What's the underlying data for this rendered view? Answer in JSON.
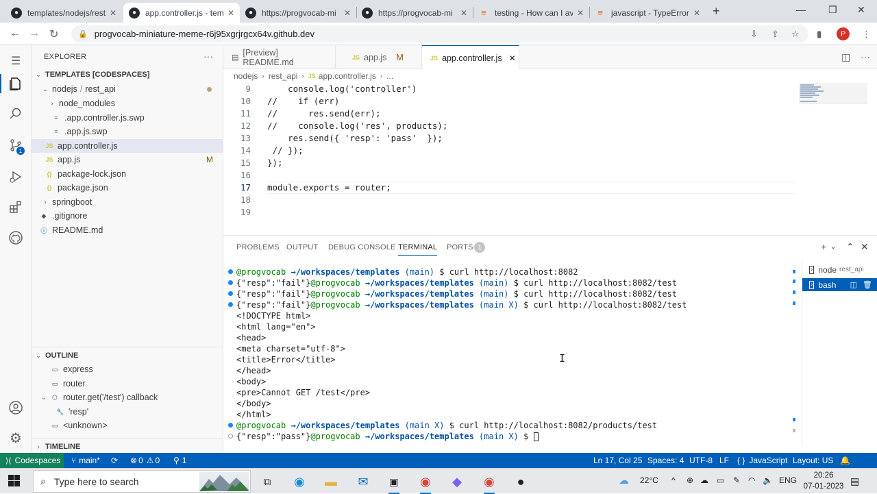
{
  "browser": {
    "tabs": [
      {
        "title": "templates/nodejs/rest"
      },
      {
        "title": "app.controller.js - tem"
      },
      {
        "title": "https://progvocab-mi"
      },
      {
        "title": "https://progvocab-mi"
      },
      {
        "title": "testing - How can I av"
      },
      {
        "title": "javascript - TypeError"
      }
    ],
    "url": "progvocab-miniature-meme-r6j95xgrjrgcx64v.github.dev",
    "profile_initial": "P"
  },
  "sidebar": {
    "title": "EXPLORER",
    "workspace": "TEMPLATES [CODESPACES]",
    "breadcrumb_folder": "nodejs",
    "breadcrumb_sub": "rest_api",
    "files": [
      {
        "label": "node_modules",
        "type": "folder"
      },
      {
        "label": ".app.controller.js.swp",
        "type": "swp"
      },
      {
        "label": ".app.js.swp",
        "type": "swp"
      },
      {
        "label": "app.controller.js",
        "type": "js",
        "selected": true
      },
      {
        "label": "app.js",
        "type": "js",
        "modified": "M"
      },
      {
        "label": "package-lock.json",
        "type": "json"
      },
      {
        "label": "package.json",
        "type": "json"
      },
      {
        "label": "springboot",
        "type": "folder"
      },
      {
        "label": ".gitignore",
        "type": "git"
      },
      {
        "label": "README.md",
        "type": "md"
      }
    ],
    "outline_title": "OUTLINE",
    "outline": [
      {
        "label": "express"
      },
      {
        "label": "router"
      },
      {
        "label": "router.get('/test') callback"
      },
      {
        "label": "'resp'"
      },
      {
        "label": "<unknown>"
      }
    ],
    "timeline_title": "TIMELINE"
  },
  "editor": {
    "tabs": [
      {
        "label": "[Preview] README.md"
      },
      {
        "label": "app.js",
        "mark": "M"
      },
      {
        "label": "app.controller.js"
      }
    ],
    "breadcrumb": [
      "nodejs",
      "rest_api",
      "app.controller.js",
      "..."
    ],
    "lines": [
      {
        "n": "9",
        "text": "    console.log('controller')"
      },
      {
        "n": "10",
        "text": "//    if (err)"
      },
      {
        "n": "11",
        "text": "//      res.send(err);"
      },
      {
        "n": "12",
        "text": "//    console.log('res', products);"
      },
      {
        "n": "13",
        "text": "    res.send({ 'resp': 'pass'  });"
      },
      {
        "n": "14",
        "text": " // });"
      },
      {
        "n": "15",
        "text": "});"
      },
      {
        "n": "16",
        "text": ""
      },
      {
        "n": "17",
        "text": "module.exports = router;"
      },
      {
        "n": "18",
        "text": ""
      },
      {
        "n": "19",
        "text": ""
      }
    ]
  },
  "panel": {
    "tabs": [
      "PROBLEMS",
      "OUTPUT",
      "DEBUG CONSOLE",
      "TERMINAL",
      "PORTS"
    ],
    "ports_count": "1",
    "terminals": [
      {
        "name": "node",
        "sub": "rest_api"
      },
      {
        "name": "bash"
      }
    ],
    "prompt_user": "@progvocab",
    "prompt_path": "/workspaces/templates",
    "prompt_branch": "(main)",
    "prompt_branch_x": "(main X)",
    "lines": [
      {
        "pre": "",
        "branch": "(main)",
        "cmd": " $ curl http://localhost:8082"
      },
      {
        "pre": "{\"resp\":\"fail\"}",
        "branch": "(main)",
        "cmd": " $ curl http://localhost:8082/test"
      },
      {
        "pre": "{\"resp\":\"fail\"}",
        "branch": "(main)",
        "cmd": " $ curl http://localhost:8082/test"
      },
      {
        "pre": "{\"resp\":\"fail\"}",
        "branch": "(main X)",
        "cmd": " $ curl http://localhost:8082/test"
      }
    ],
    "html_output": [
      "<!DOCTYPE html>",
      "<html lang=\"en\">",
      "<head>",
      "<meta charset=\"utf-8\">",
      "<title>Error</title>",
      "</head>",
      "<body>",
      "<pre>Cannot GET /test</pre>",
      "</body>",
      "</html>"
    ],
    "last_cmd": " $ curl http://localhost:8082/products/test",
    "last_output": "{\"resp\":\"pass\"}",
    "last_prompt_tail": " $ "
  },
  "statusbar": {
    "remote": "Codespaces",
    "branch": "main*",
    "errors": "0",
    "warnings": "0",
    "ports": "1",
    "position": "Ln 17, Col 25",
    "spaces": "Spaces: 4",
    "encoding": "UTF-8",
    "eol": "LF",
    "language": "JavaScript",
    "layout": "Layout: US"
  },
  "taskbar": {
    "search_placeholder": "Type here to search",
    "temperature": "22°C",
    "lang": "ENG",
    "time": "20:26",
    "date": "07-01-2023"
  },
  "colors": {
    "accent": "#005fb8",
    "remote": "#16825d",
    "prompt_user": "#008000",
    "prompt_path": "#0451a5"
  }
}
